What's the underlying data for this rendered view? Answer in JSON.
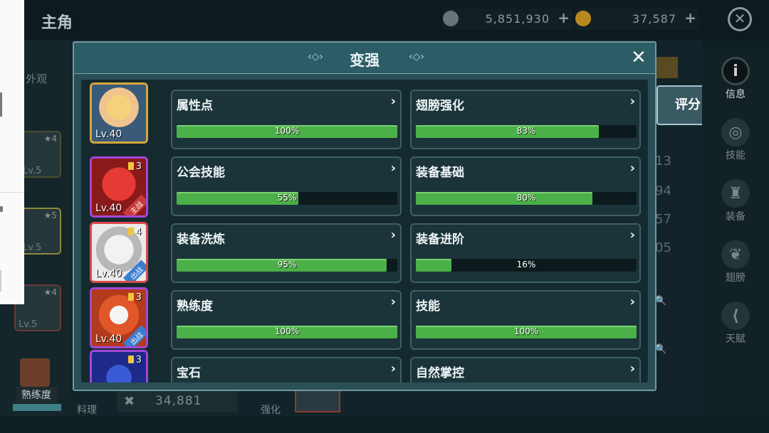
{
  "header": {
    "title": "主角",
    "currencies": [
      {
        "icon": "silver-coin-icon",
        "value": "5,851,930",
        "plus": "+"
      },
      {
        "icon": "gold-coin-icon",
        "value": "37,587",
        "plus": "+"
      }
    ],
    "close": "✕"
  },
  "background": {
    "appearance_label": "外观",
    "left_cards": [
      {
        "star": "★4",
        "level": "Lv.5"
      },
      {
        "star": "★5",
        "level": "Lv.5"
      },
      {
        "star": "★4",
        "level": "Lv.5"
      }
    ],
    "proficiency_label": "熟练度",
    "cooking_label": "料理",
    "combat_power": "34,881",
    "enhance_label": "强化",
    "score_button": "评分",
    "numbers": [
      "13",
      "94",
      "57",
      "05"
    ]
  },
  "right_tabs": [
    {
      "label": "信息",
      "icon": "info-icon",
      "glyph": "i",
      "active": true
    },
    {
      "label": "技能",
      "icon": "skill-icon",
      "glyph": "◎",
      "active": false
    },
    {
      "label": "装备",
      "icon": "armor-icon",
      "glyph": "♜",
      "active": false
    },
    {
      "label": "翅膀",
      "icon": "wing-icon",
      "glyph": "❦",
      "active": false
    },
    {
      "label": "天赋",
      "icon": "talent-icon",
      "glyph": "⟨",
      "active": false
    }
  ],
  "modal": {
    "title": "变强",
    "close": "✕",
    "heroes": [
      {
        "level": "Lv.40",
        "stars": "",
        "tag": "",
        "frame": "#d9a73a"
      },
      {
        "level": "Lv.40",
        "stars": "3",
        "tag": "主战",
        "frame": "#a348d8"
      },
      {
        "level": "Lv.40",
        "stars": "4",
        "tag": "出战",
        "frame": "#d84a4a"
      },
      {
        "level": "Lv.40",
        "stars": "3",
        "tag": "出战",
        "frame": "#a348d8"
      },
      {
        "level": "",
        "stars": "3",
        "tag": "",
        "frame": "#a348d8"
      }
    ],
    "stats": [
      {
        "label": "属性点",
        "value": 100,
        "text": "100%"
      },
      {
        "label": "翅膀强化",
        "value": 83,
        "text": "83%"
      },
      {
        "label": "公会技能",
        "value": 55,
        "text": "55%"
      },
      {
        "label": "装备基础",
        "value": 80,
        "text": "80%"
      },
      {
        "label": "装备洗炼",
        "value": 95,
        "text": "95%"
      },
      {
        "label": "装备进阶",
        "value": 16,
        "text": "16%"
      },
      {
        "label": "熟练度",
        "value": 100,
        "text": "100%"
      },
      {
        "label": "技能",
        "value": 100,
        "text": "100%"
      },
      {
        "label": "宝石",
        "value": 0,
        "text": ""
      },
      {
        "label": "自然掌控",
        "value": 0,
        "text": ""
      }
    ],
    "arrow": "›"
  },
  "colors": {
    "bar_fill": "#4cb048",
    "bar_bg": "#0c1a1e",
    "modal_bg": "#2a4f56"
  }
}
